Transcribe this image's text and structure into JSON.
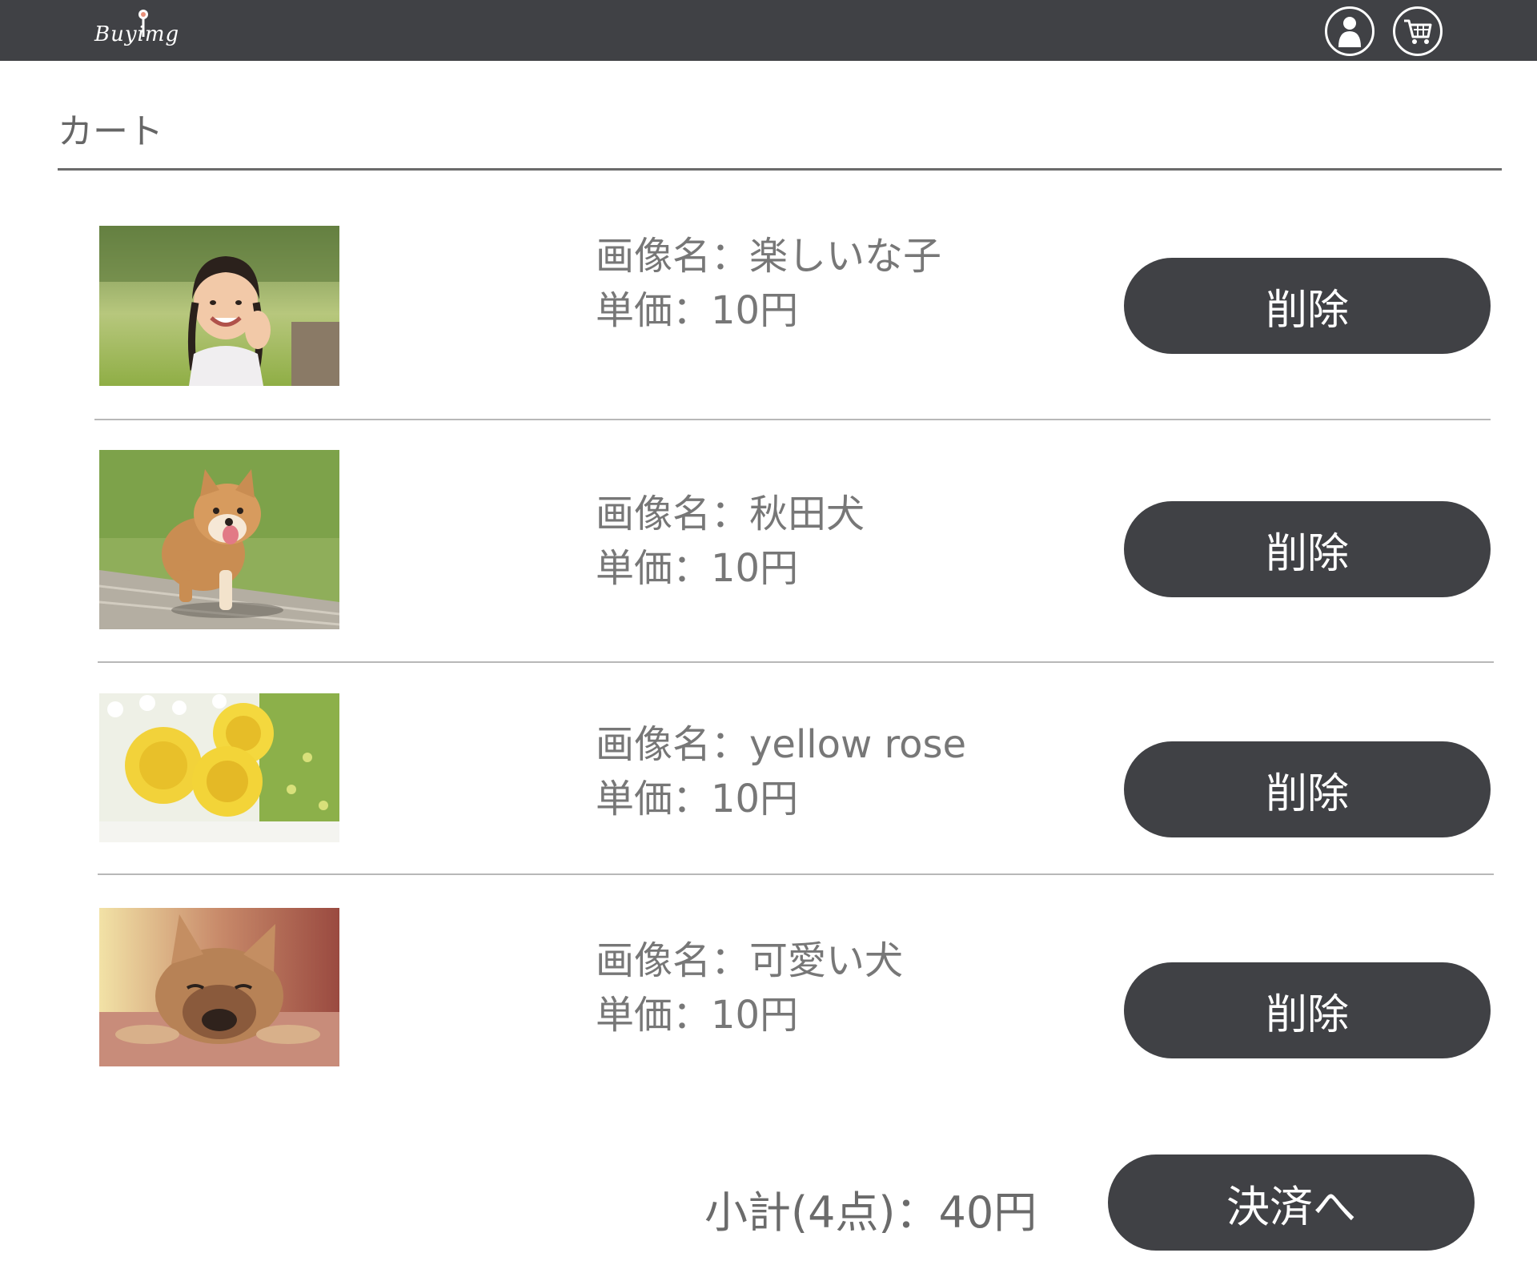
{
  "header": {
    "logo_text": "Buyimg",
    "icons": {
      "user": "user-icon",
      "cart": "cart-icon"
    },
    "background": "#404145"
  },
  "page": {
    "title": "カート"
  },
  "cart": {
    "items": [
      {
        "name_line": "画像名：楽しいな子",
        "price_line": "単価：10円",
        "delete_label": "削除",
        "image": "girl-photo"
      },
      {
        "name_line": "画像名：秋田犬",
        "price_line": "単価：10円",
        "delete_label": "削除",
        "image": "puppy-photo"
      },
      {
        "name_line": "画像名：yellow rose",
        "price_line": "単価：10円",
        "delete_label": "削除",
        "image": "yellow-rose-photo"
      },
      {
        "name_line": "画像名：可愛い犬",
        "price_line": "単価：10円",
        "delete_label": "削除",
        "image": "bulldog-photo"
      }
    ],
    "subtotal": "小計(4点)：40円",
    "checkout_label": "決済へ"
  },
  "colors": {
    "button": "#404145",
    "button_text": "#ffffff",
    "text": "#777777"
  }
}
